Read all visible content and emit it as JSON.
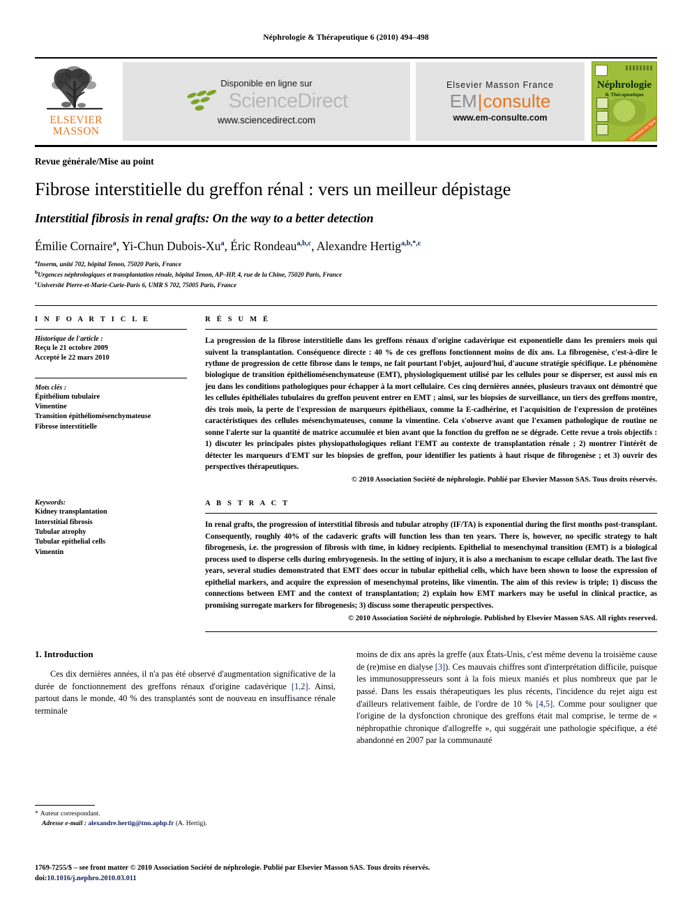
{
  "running_head": "Néphrologie & Thérapeutique 6 (2010) 494–498",
  "masthead": {
    "elsevier_logo_line1": "ELSEVIER",
    "elsevier_logo_line2": "MASSON",
    "sciencedirect": {
      "available_label": "Disponible en ligne sur",
      "wordmark": "ScienceDirect",
      "url": "www.sciencedirect.com",
      "leaf_color": "#7BA428"
    },
    "emconsulte": {
      "publisher": "Elsevier Masson France",
      "logo_em": "EM",
      "logo_divider": "|",
      "logo_consulte": "consulte",
      "url": "www.em-consulte.com",
      "accent_color": "#E8741E"
    },
    "cover": {
      "title": "Néphrologie",
      "subtitle": "& Thérapeutique",
      "ribbon": "Consultez en ligne",
      "bg_color": "#9FBF3B"
    }
  },
  "article": {
    "type": "Revue générale/Mise au point",
    "title_fr": "Fibrose interstitielle du greffon rénal : vers un meilleur dépistage",
    "title_en": "Interstitial fibrosis in renal grafts: On the way to a better detection",
    "authors": [
      {
        "name": "Émilie Cornaire",
        "marks": "a",
        "sep": ", "
      },
      {
        "name": "Yi-Chun Dubois-Xu",
        "marks": "a",
        "sep": ", "
      },
      {
        "name": "Éric Rondeau",
        "marks": "a,b,c",
        "sep": ", "
      },
      {
        "name": "Alexandre Hertig",
        "marks": "a,b,*,c",
        "sep": ""
      }
    ],
    "affiliations": [
      {
        "mark": "a",
        "text": "Inserm, unité 702, hôpital Tenon, 75020 Paris, France"
      },
      {
        "mark": "b",
        "text": "Urgences néphrologiques et transplantation rénale, hôpital Tenon, AP–HP, 4, rue de la Chine, 75020 Paris, France"
      },
      {
        "mark": "c",
        "text": "Université Pierre-et-Marie-Curie-Paris 6, UMR S 702, 75005 Paris, France"
      }
    ]
  },
  "info_article": {
    "heading": "I N F O   A R T I C L E",
    "history_label": "Historique de l'article :",
    "history_lines": [
      "Reçu le 21 octobre 2009",
      "Accepté le 22 mars 2010"
    ],
    "motscles_label": "Mots clés :",
    "motscles": [
      "Épithélium tubulaire",
      "Vimentine",
      "Transition épithéliomésenchymateuse",
      "Fibrose interstitielle"
    ],
    "keywords_label": "Keywords:",
    "keywords": [
      "Kidney transplantation",
      "Interstitial fibrosis",
      "Tubular atrophy",
      "Tubular epithelial cells",
      "Vimentin"
    ]
  },
  "resume": {
    "heading": "R É S U M É",
    "text": "La progression de la fibrose interstitielle dans les greffons rénaux d'origine cadavérique est exponentielle dans les premiers mois qui suivent la transplantation. Conséquence directe : 40 % de ces greffons fonctionnent moins de dix ans. La fibrogenèse, c'est-à-dire le rythme de progression de cette fibrose dans le temps, ne fait pourtant l'objet, aujourd'hui, d'aucune stratégie spécifique. Le phénomène biologique de transition épithéliomésenchymateuse (EMT), physiologiquement utilisé par les cellules pour se disperser, est aussi mis en jeu dans les conditions pathologiques pour échapper à la mort cellulaire. Ces cinq dernières années, plusieurs travaux ont démontré que les cellules épithéliales tubulaires du greffon peuvent entrer en EMT ; ainsi, sur les biopsies de surveillance, un tiers des greffons montre, dès trois mois, la perte de l'expression de marqueurs épithéliaux, comme la E-cadhérine, et l'acquisition de l'expression de protéines caractéristiques des cellules mésenchymateuses, comme la vimentine. Cela s'observe avant que l'examen pathologique de routine ne sonne l'alerte sur la quantité de matrice accumulée et bien avant que la fonction du greffon ne se dégrade. Cette revue a trois objectifs : 1) discuter les principales pistes physiopathologiques reliant l'EMT au contexte de transplantation rénale ; 2) montrer l'intérêt de détecter les marqueurs d'EMT sur les biopsies de greffon, pour identifier les patients à haut risque de fibrogenèse ; et 3) ouvrir des perspectives thérapeutiques.",
    "copyright": "© 2010 Association Société de néphrologie. Publié par Elsevier Masson SAS. Tous droits réservés."
  },
  "abstract": {
    "heading": "A B S T R A C T",
    "text": "In renal grafts, the progression of interstitial fibrosis and tubular atrophy (IF/TA) is exponential during the first months post-transplant. Consequently, roughly 40% of the cadaveric grafts will function less than ten years. There is, however, no specific strategy to halt fibrogenesis, i.e. the progression of fibrosis with time, in kidney recipients. Epithelial to mesenchymal transition (EMT) is a biological process used to disperse cells during embryogenesis. In the setting of injury, it is also a mechanism to escape cellular death. The last five years, several studies demonstrated that EMT does occur in tubular epithelial cells, which have been shown to loose the expression of epithelial markers, and acquire the expression of mesenchymal proteins, like vimentin. The aim of this review is triple; 1) discuss the connections between EMT and the context of transplantation; 2) explain how EMT markers may be useful in clinical practice, as promising surrogate markers for fibrogenesis; 3) discuss some therapeutic perspectives.",
    "copyright": "© 2010 Association Société de néphrologie. Published by Elsevier Masson SAS. All rights reserved."
  },
  "body": {
    "section_number_title": "1.  Introduction",
    "col1_para1_a": "Ces dix dernières années, il n'a pas été observé d'augmentation significative de la durée de fonctionnement des greffons rénaux d'origine cadavérique ",
    "col1_ref1": "[1,2]",
    "col1_para1_b": ". Ainsi, partout dans le monde, 40 % des transplantés sont de nouveau en insuffisance rénale terminale",
    "col2_para_a": "moins de dix ans après la greffe (aux États-Unis, c'est même devenu la troisième cause de (re)mise en dialyse ",
    "col2_ref1": "[3]",
    "col2_para_b": "). Ces mauvais chiffres sont d'interprétation difficile, puisque les immunosuppresseurs sont à la fois mieux maniés et plus nombreux que par le passé. Dans les essais thérapeutiques les plus récents, l'incidence du rejet aigu est d'ailleurs relativement faible, de l'ordre de 10 % ",
    "col2_ref2": "[4,5]",
    "col2_para_c": ". Comme pour souligner que l'origine de la dysfonction chronique des greffons était mal comprise, le terme de « néphropathie chronique d'allogreffe », qui suggérait une pathologie spécifique, a été abandonné en 2007 par la communauté"
  },
  "footnote": {
    "star": "*",
    "corresponding": "Auteur correspondant.",
    "email_label": "Adresse e-mail :",
    "email": "alexandre.hertig@tnn.aphp.fr",
    "email_owner": "(A. Hertig)."
  },
  "page_footer": {
    "line1": "1769-7255/$ – see front matter © 2010 Association Société de néphrologie. Publié par Elsevier Masson SAS. Tous droits réservés.",
    "doi_prefix": "doi:",
    "doi": "10.1016/j.nephro.2010.03.011"
  }
}
